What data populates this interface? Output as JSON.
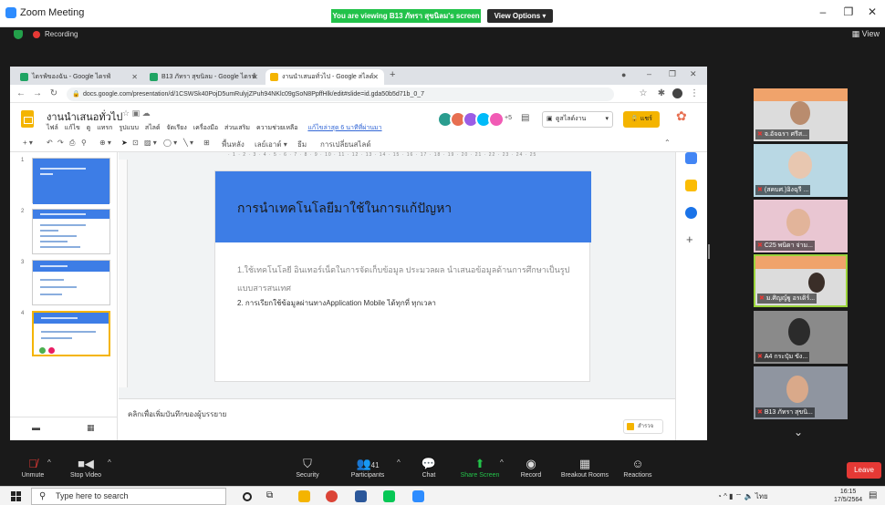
{
  "zoom": {
    "window_title": "Zoom Meeting",
    "viewing_banner": "You are viewing B13 ภัทรา สุขนิลม's screen",
    "view_options": "View Options ▾",
    "recording_label": "Recording",
    "view_button": "View",
    "controls": [
      {
        "label": "Unmute",
        "icon": "microphone-muted-icon"
      },
      {
        "label": "Stop Video",
        "icon": "video-camera-icon"
      },
      {
        "label": "Security",
        "icon": "shield-icon"
      },
      {
        "label": "Participants",
        "icon": "participants-icon",
        "count": "41"
      },
      {
        "label": "Chat",
        "icon": "chat-icon"
      },
      {
        "label": "Share Screen",
        "icon": "share-screen-icon"
      },
      {
        "label": "Record",
        "icon": "record-icon"
      },
      {
        "label": "Breakout Rooms",
        "icon": "breakout-rooms-icon"
      },
      {
        "label": "Reactions",
        "icon": "reactions-icon"
      }
    ],
    "end_label": "Leave",
    "participants": [
      {
        "name": "จ.อัจฉรา ศรีส..."
      },
      {
        "name": "(สคบศ.)อิงฉุรี ..."
      },
      {
        "name": "C25 พนิดา จ่าม..."
      },
      {
        "name": "ม.ศิญญ์ฐู อรเดิร์..."
      },
      {
        "name": "A4 กระปุ๋ม ขัง..."
      },
      {
        "name": "B13 ภัทรา สุขนิ..."
      }
    ]
  },
  "browser": {
    "tabs": [
      {
        "label": "ไดรฟ์ของฉัน - Google ไดรฟ์"
      },
      {
        "label": "B13 ภัทรา สุขนิลม - Google ไดรฟ์"
      },
      {
        "label": "งานนำเสนอทั่วไป - Google สไลด์"
      }
    ],
    "url": "docs.google.com/presentation/d/1CSWSk40PojD5umRulyjZPuh94NKlc09gSoN8PpffHlk/edit#slide=id.gda50b5d71b_0_7"
  },
  "slides": {
    "doc_title": "งานนำเสนอทั่วไป",
    "menu": [
      "ไฟล์",
      "แก้ไข",
      "ดู",
      "แทรก",
      "รูปแบบ",
      "สไลด์",
      "จัดเรียง",
      "เครื่องมือ",
      "ส่วนเสริม",
      "ความช่วยเหลือ"
    ],
    "last_edit": "แก้ไขล่าสุด 6 นาทีที่ผ่านมา",
    "collab_count": "+5",
    "present_label": "ดูสไลด์งาน",
    "share_label": "แชร์",
    "toolbar": {
      "background": "พื้นหลัง",
      "layout": "เลย์เอาต์ ▾",
      "theme": "ธีม",
      "transition": "การเปลี่ยนสไลด์"
    },
    "ruler": "· 1 · 2 · 3 · 4 · 5 · 6 · 7 · 8 · 9 · 10 · 11 · 12 · 13 · 14 · 15 · 16 · 17 · 18 · 19 · 20 · 21 · 22 · 23 · 24 · 25",
    "thumbnails": [
      {
        "num": "1"
      },
      {
        "num": "2"
      },
      {
        "num": "3"
      },
      {
        "num": "4"
      }
    ],
    "current_slide": {
      "title": "การนำเทคโนโลยีมาใช้ในการแก้ปัญหา",
      "body1": "1.ใช้เทคโนโลยี อินเทอร์เน็ตในการจัดเก็บข้อมูล ประมวลผล นำเสนอข้อมูลด้านการศึกษาเป็นรูปแบบสารสนเทศ",
      "body2": "2. การเรียกใช้ข้อมูลผ่านทางApplication  Mobile ได้ทุกที่ ทุกเวลา"
    },
    "notes_placeholder": "คลิกเพื่อเพิ่มบันทึกของผู้บรรยาย",
    "explore_label": "สำรวจ"
  },
  "taskbar": {
    "search_placeholder": "Type here to search",
    "lang": "ไทย",
    "time": "16:15",
    "date": "17/5/2564"
  },
  "colors": {
    "slide_header": "#3d7de6",
    "slides_accent": "#f4b400",
    "zoom_green": "#23c34a",
    "leave_red": "#e53935"
  }
}
